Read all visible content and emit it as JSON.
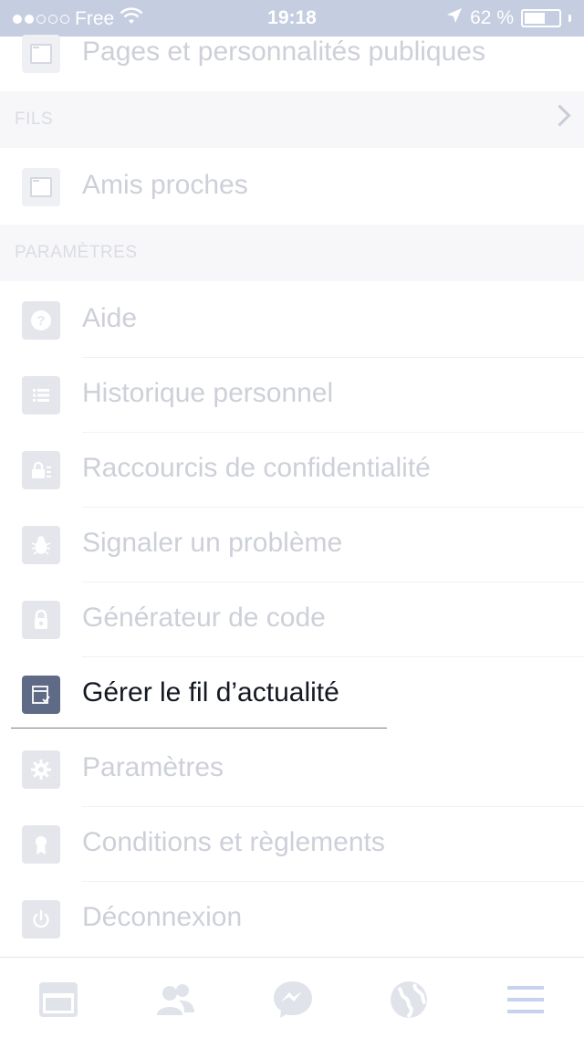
{
  "status": {
    "carrier": "Free",
    "signal_dots_full": 2,
    "signal_dots_total": 5,
    "time": "19:18",
    "battery_percent": "62 %",
    "battery_level": 0.62
  },
  "top_row": {
    "label": "Pages et personnalités publiques",
    "icon": "feed-icon"
  },
  "sections": {
    "fils": "FILS",
    "parametres": "PARAMÈTRES"
  },
  "fils_items": [
    {
      "label": "Amis proches",
      "icon": "feed-icon"
    }
  ],
  "settings_items": [
    {
      "label": "Aide",
      "icon": "help-icon"
    },
    {
      "label": "Historique personnel",
      "icon": "list-icon"
    },
    {
      "label": "Raccourcis de confidentialité",
      "icon": "privacy-lock-icon"
    },
    {
      "label": "Signaler un problème",
      "icon": "bug-icon"
    },
    {
      "label": "Générateur de code",
      "icon": "padlock-icon"
    },
    {
      "label": "Gérer le fil d’actualité",
      "icon": "news-feed-preferences-icon",
      "active": true
    },
    {
      "label": "Paramètres",
      "icon": "gear-icon"
    },
    {
      "label": "Conditions et règlements",
      "icon": "badge-icon"
    },
    {
      "label": "Déconnexion",
      "icon": "power-icon"
    }
  ],
  "tabbar": [
    {
      "name": "news-feed",
      "icon": "news-feed-icon"
    },
    {
      "name": "friend-requests",
      "icon": "friends-icon"
    },
    {
      "name": "messenger",
      "icon": "messenger-icon"
    },
    {
      "name": "notifications",
      "icon": "globe-icon"
    },
    {
      "name": "more",
      "icon": "menu-icon",
      "active": true
    }
  ],
  "colors": {
    "status_bar": "#c5cde0",
    "active_icon_bg": "#5f6a86",
    "faded_text": "#cdd0d8",
    "active_text": "#141823",
    "tab_active": "#c7d2ef"
  }
}
